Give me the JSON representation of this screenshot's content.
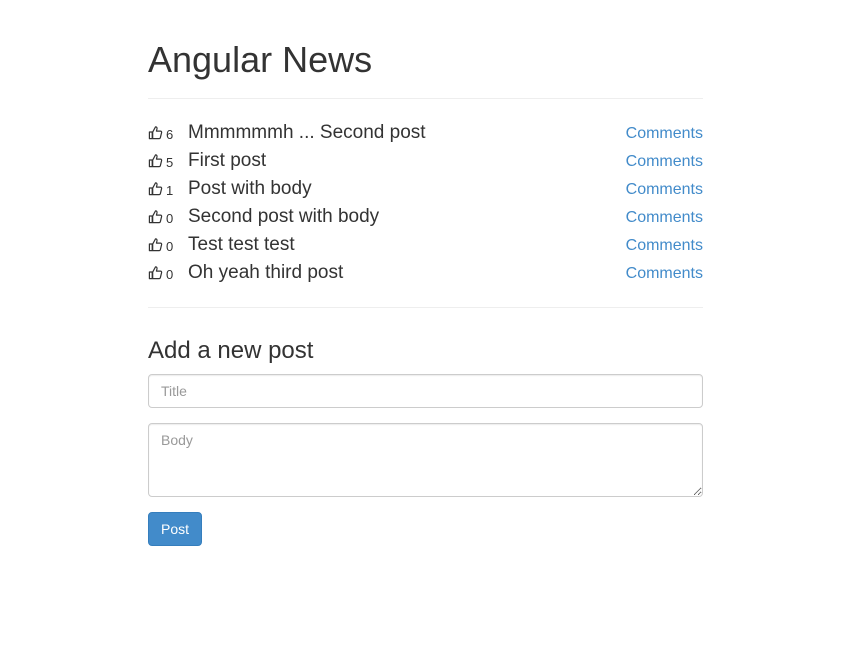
{
  "page_title": "Angular News",
  "posts": [
    {
      "votes": "6",
      "title": "Mmmmmmh ... Second post",
      "comments_label": "Comments",
      "upvote_icon": "thumbs-up-icon"
    },
    {
      "votes": "5",
      "title": "First post",
      "comments_label": "Comments",
      "upvote_icon": "thumbs-up-icon"
    },
    {
      "votes": "1",
      "title": "Post with body",
      "comments_label": "Comments",
      "upvote_icon": "thumbs-up-icon"
    },
    {
      "votes": "0",
      "title": "Second post with body",
      "comments_label": "Comments",
      "upvote_icon": "thumbs-up-icon"
    },
    {
      "votes": "0",
      "title": "Test test test",
      "comments_label": "Comments",
      "upvote_icon": "thumbs-up-icon"
    },
    {
      "votes": "0",
      "title": "Oh yeah third post",
      "comments_label": "Comments",
      "upvote_icon": "thumbs-up-icon"
    }
  ],
  "new_post_form": {
    "heading": "Add a new post",
    "title_placeholder": "Title",
    "title_value": "",
    "body_placeholder": "Body",
    "body_value": "",
    "submit_label": "Post"
  },
  "colors": {
    "text": "#333333",
    "link": "#428bca",
    "primary_button": "#428bca",
    "divider": "#eeeeee",
    "input_border": "#cccccc"
  }
}
